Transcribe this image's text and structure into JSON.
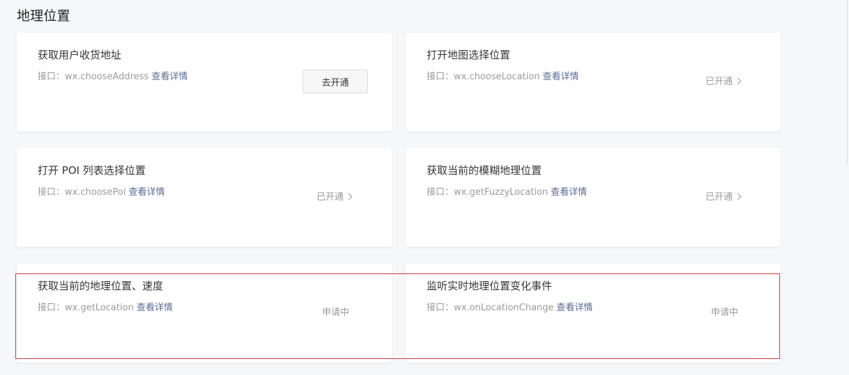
{
  "section": {
    "title": "地理位置"
  },
  "cards": [
    {
      "title": "获取用户收货地址",
      "api_prefix": "接口：",
      "api": "wx.chooseAddress",
      "detail_label": "查看详情",
      "action_label": "去开通"
    },
    {
      "title": "打开地图选择位置",
      "api_prefix": "接口：",
      "api": "wx.chooseLocation",
      "detail_label": "查看详情",
      "status_label": "已开通"
    },
    {
      "title": "打开 POI 列表选择位置",
      "api_prefix": "接口：",
      "api": "wx.choosePoi",
      "detail_label": "查看详情",
      "status_label": "已开通"
    },
    {
      "title": "获取当前的模糊地理位置",
      "api_prefix": "接口：",
      "api": "wx.getFuzzyLocation",
      "detail_label": "查看详情",
      "status_label": "已开通"
    },
    {
      "title": "获取当前的地理位置、速度",
      "api_prefix": "接口：",
      "api": "wx.getLocation",
      "detail_label": "查看详情",
      "status_label": "申请中"
    },
    {
      "title": "监听实时地理位置变化事件",
      "api_prefix": "接口：",
      "api": "wx.onLocationChange",
      "detail_label": "查看详情",
      "status_label": "申请中"
    }
  ],
  "colors": {
    "link": "#576b95",
    "highlight": "#d9363e",
    "background": "#f6f7f9"
  },
  "icons": [
    "chevron-right-icon"
  ]
}
